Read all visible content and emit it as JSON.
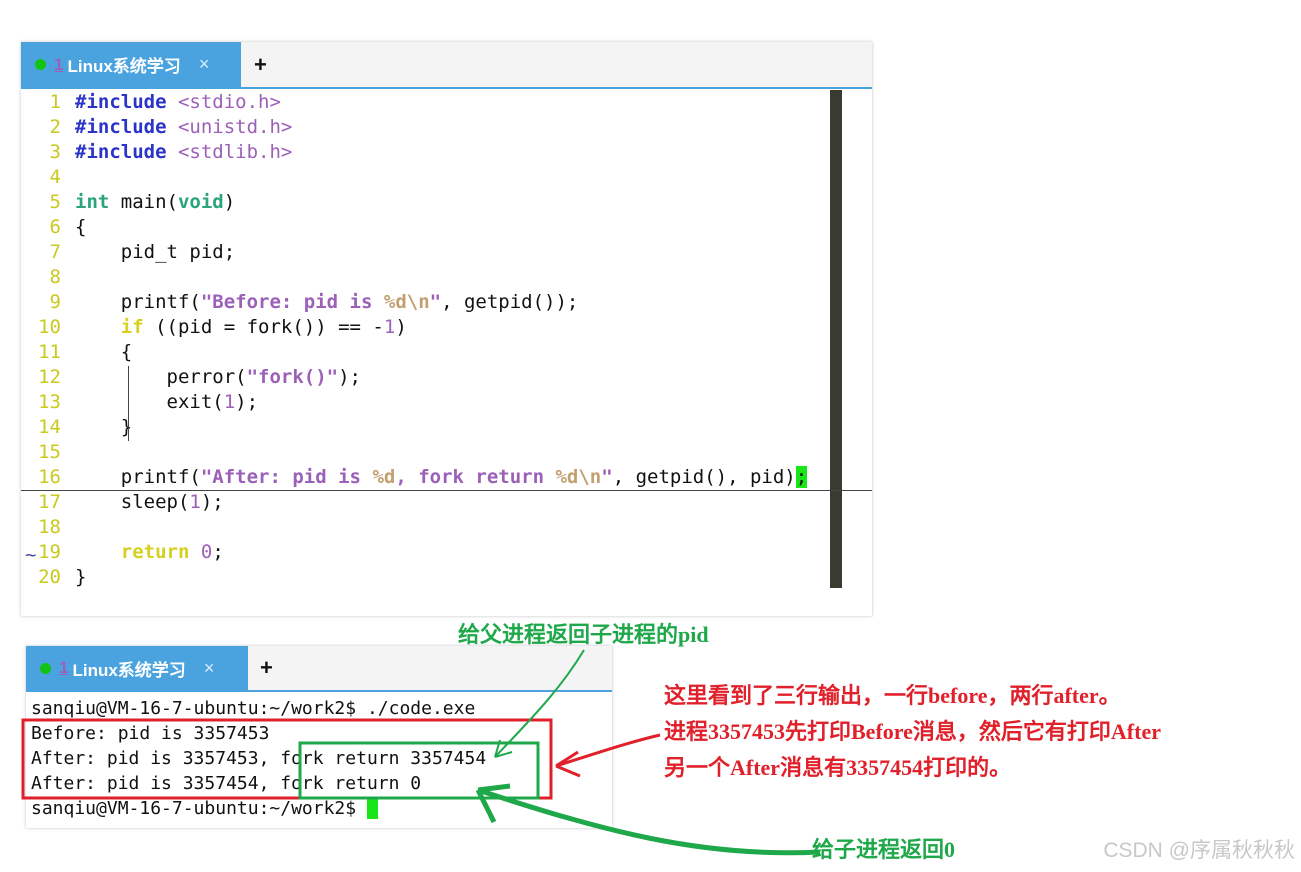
{
  "editor": {
    "tab": {
      "number": "1",
      "title": "Linux系统学习",
      "close": "×"
    },
    "new_tab": "+",
    "lines": [
      {
        "n": "1",
        "parts": [
          [
            "kw-pre",
            "#include "
          ],
          [
            "inc",
            "<stdio.h>"
          ]
        ]
      },
      {
        "n": "2",
        "parts": [
          [
            "kw-pre",
            "#include "
          ],
          [
            "inc",
            "<unistd.h>"
          ]
        ]
      },
      {
        "n": "3",
        "parts": [
          [
            "kw-pre",
            "#include "
          ],
          [
            "inc",
            "<stdlib.h>"
          ]
        ]
      },
      {
        "n": "4",
        "parts": []
      },
      {
        "n": "5",
        "parts": [
          [
            "type",
            "int"
          ],
          [
            "plain",
            " main("
          ],
          [
            "type",
            "void"
          ],
          [
            "plain",
            ")"
          ]
        ]
      },
      {
        "n": "6",
        "parts": [
          [
            "plain",
            "{"
          ]
        ]
      },
      {
        "n": "7",
        "parts": [
          [
            "plain",
            "    pid_t pid;"
          ]
        ]
      },
      {
        "n": "8",
        "parts": []
      },
      {
        "n": "9",
        "parts": [
          [
            "plain",
            "    printf("
          ],
          [
            "str",
            "\"Before: pid is "
          ],
          [
            "fmt",
            "%d\\n"
          ],
          [
            "str",
            "\""
          ],
          [
            "plain",
            ", getpid());"
          ]
        ]
      },
      {
        "n": "10",
        "parts": [
          [
            "plain",
            "    "
          ],
          [
            "kw",
            "if"
          ],
          [
            "plain",
            " ((pid = fork()) == -"
          ],
          [
            "num",
            "1"
          ],
          [
            "plain",
            ")"
          ]
        ]
      },
      {
        "n": "11",
        "parts": [
          [
            "plain",
            "    {"
          ]
        ]
      },
      {
        "n": "12",
        "parts": [
          [
            "plain",
            "        perror("
          ],
          [
            "str",
            "\"fork()\""
          ],
          [
            "plain",
            ");"
          ]
        ]
      },
      {
        "n": "13",
        "parts": [
          [
            "plain",
            "        exit("
          ],
          [
            "num",
            "1"
          ],
          [
            "plain",
            ");"
          ]
        ]
      },
      {
        "n": "14",
        "parts": [
          [
            "plain",
            "    }"
          ]
        ]
      },
      {
        "n": "15",
        "parts": []
      },
      {
        "n": "16",
        "parts": [
          [
            "plain",
            "    printf("
          ],
          [
            "str",
            "\"After: pid is "
          ],
          [
            "fmt",
            "%d"
          ],
          [
            "str",
            ", fork return "
          ],
          [
            "fmt",
            "%d\\n"
          ],
          [
            "str",
            "\""
          ],
          [
            "plain",
            ", getpid(), pid)"
          ],
          [
            "caret-g",
            ";"
          ]
        ]
      },
      {
        "n": "17",
        "parts": [
          [
            "plain",
            "    sleep("
          ],
          [
            "num",
            "1"
          ],
          [
            "plain",
            ");"
          ]
        ]
      },
      {
        "n": "18",
        "parts": []
      },
      {
        "n": "19",
        "parts": [
          [
            "plain",
            "    "
          ],
          [
            "kw",
            "return"
          ],
          [
            "plain",
            " "
          ],
          [
            "num",
            "0"
          ],
          [
            "plain",
            ";"
          ]
        ]
      },
      {
        "n": "20",
        "parts": [
          [
            "plain",
            "}"
          ]
        ]
      }
    ],
    "tilde": "~"
  },
  "terminal": {
    "tab": {
      "number": "1",
      "title": "Linux系统学习",
      "close": "×"
    },
    "new_tab": "+",
    "lines": [
      "sanqiu@VM-16-7-ubuntu:~/work2$ ./code.exe",
      "Before: pid is 3357453",
      "After: pid is 3357453, fork return 3357454",
      "After: pid is 3357454, fork return 0",
      "sanqiu@VM-16-7-ubuntu:~/work2$ "
    ]
  },
  "annotations": {
    "parent_note": "给父进程返回子进程的pid",
    "child_note": "给子进程返回0",
    "explain_1": "这里看到了三行输出，一行before，两行after。",
    "explain_2": "进程3357453先打印Before消息，然后它有打印After",
    "explain_3": "另一个After消息有3357454打印的。"
  },
  "watermark": "CSDN @序属秋秋秋",
  "colors": {
    "tab_blue": "#4aa3df",
    "green_mark": "#1ea84a",
    "red_mark": "#e0202a",
    "cursor_green": "#19e619"
  }
}
